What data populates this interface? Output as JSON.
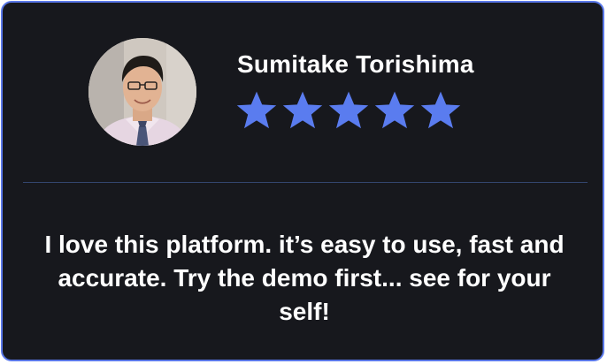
{
  "testimonial": {
    "reviewer_name": "Sumitake Torishima",
    "avatar_icon": "reviewer-photo",
    "rating": 5,
    "rating_max": 5,
    "star_color": "#5a7cef",
    "accent_border_color": "#5a78e8",
    "background_color": "#17181d",
    "quote": "I love this platform. it’s easy to use, fast and accurate. Try the demo first... see for your self!"
  }
}
